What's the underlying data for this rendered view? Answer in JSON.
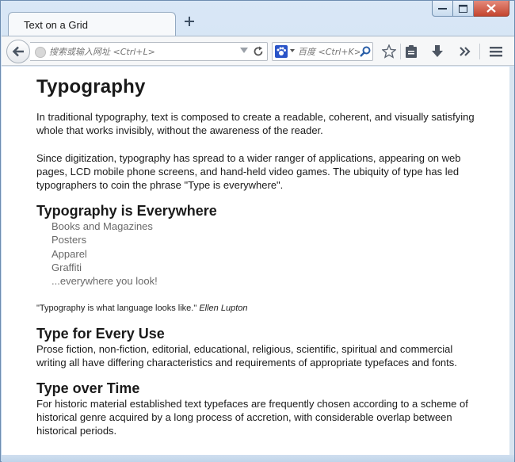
{
  "browser": {
    "tab_title": "Text on a Grid",
    "url_placeholder": "搜索或输入网址 <Ctrl+L>",
    "search_placeholder": "百度 <Ctrl+K>"
  },
  "page": {
    "title": "Typography",
    "intro_paragraphs": [
      "In traditional typography, text is composed to create a readable, coherent, and visually satisfying whole that works invisibly, without the awareness of the reader.",
      "Since digitization, typography has spread to a wider ranger of applications, appearing on web pages, LCD mobile phone screens, and hand-held video games. The ubiquity of type has led typographers to coin the phrase \"Type is everywhere\"."
    ],
    "everywhere_heading": "Typography is Everywhere",
    "everywhere_list": [
      "Books and Magazines",
      "Posters",
      "Apparel",
      "Graffiti",
      "...everywhere you look!"
    ],
    "quote_text": "\"Typography is what language looks like.\"",
    "quote_author": "Ellen Lupton",
    "use_heading": "Type for Every Use",
    "use_text": "Prose fiction, non-fiction, editorial, educational, religious, scientific, spiritual and commercial writing all have differing characteristics and requirements of appropriate typefaces and fonts.",
    "time_heading": "Type over Time",
    "time_text": "For historic material established text typefaces are frequently chosen according to a scheme of historical genre acquired by a long process of accretion, with considerable overlap between historical periods."
  }
}
